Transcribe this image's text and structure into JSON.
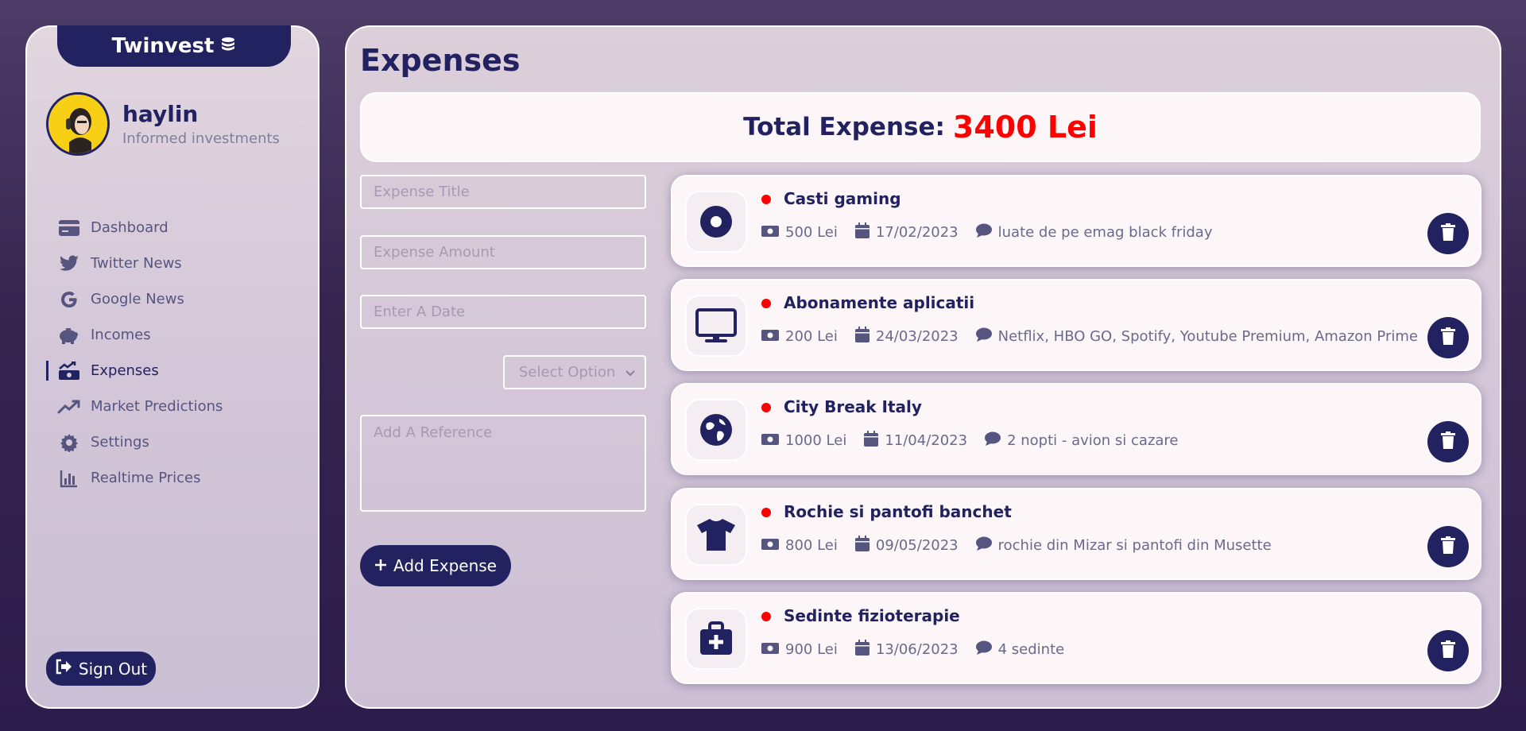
{
  "brand": {
    "name": "Twinvest",
    "icon": "coins-icon"
  },
  "user": {
    "name": "haylin",
    "subtitle": "Informed investments"
  },
  "nav": [
    {
      "label": "Dashboard",
      "icon": "card-icon",
      "active": false
    },
    {
      "label": "Twitter News",
      "icon": "twitter-icon",
      "active": false
    },
    {
      "label": "Google News",
      "icon": "google-icon",
      "active": false
    },
    {
      "label": "Incomes",
      "icon": "piggy-bank-icon",
      "active": false
    },
    {
      "label": "Expenses",
      "icon": "money-bill-trend-icon",
      "active": true
    },
    {
      "label": "Market Predictions",
      "icon": "trend-up-icon",
      "active": false
    },
    {
      "label": "Settings",
      "icon": "gear-icon",
      "active": false
    },
    {
      "label": "Realtime Prices",
      "icon": "bar-chart-icon",
      "active": false
    }
  ],
  "signout": {
    "label": "Sign Out"
  },
  "page": {
    "title": "Expenses"
  },
  "total": {
    "label": "Total Expense:",
    "value": "3400 Lei"
  },
  "form": {
    "title_placeholder": "Expense Title",
    "amount_placeholder": "Expense Amount",
    "date_placeholder": "Enter A Date",
    "select_value": "Select Option",
    "reference_placeholder": "Add A Reference",
    "add_label": "Add Expense"
  },
  "expenses": [
    {
      "title": "Casti gaming",
      "amount": "500 Lei",
      "date": "17/02/2023",
      "note": "luate de pe emag black friday",
      "icon": "record-disc-icon"
    },
    {
      "title": "Abonamente aplicatii",
      "amount": "200 Lei",
      "date": "24/03/2023",
      "note": "Netflix, HBO GO, Spotify, Youtube Premium, Amazon Prime",
      "icon": "monitor-icon"
    },
    {
      "title": "City Break Italy",
      "amount": "1000 Lei",
      "date": "11/04/2023",
      "note": "2 nopti - avion si cazare",
      "icon": "globe-icon"
    },
    {
      "title": "Rochie si pantofi banchet",
      "amount": "800 Lei",
      "date": "09/05/2023",
      "note": "rochie din Mizar si pantofi din Musette",
      "icon": "tshirt-icon"
    },
    {
      "title": "Sedinte fizioterapie",
      "amount": "900 Lei",
      "date": "13/06/2023",
      "note": "4 sedinte",
      "icon": "medical-kit-icon"
    }
  ],
  "colors": {
    "primary": "#222260",
    "accent_red": "#ff0000",
    "card_bg": "#fcf6f9"
  }
}
